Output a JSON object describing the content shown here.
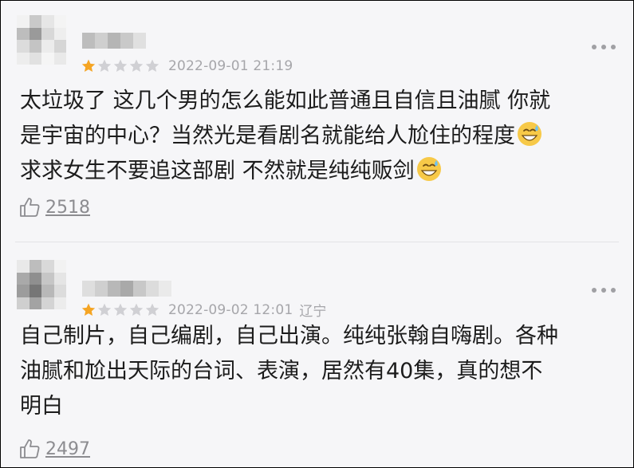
{
  "reviews": [
    {
      "rating": 1,
      "max_rating": 5,
      "date": "2022-09-01 21:19",
      "location": "",
      "content": "太垃圾了 这几个男的怎么能如此普通且自信且油腻 你就\n是宇宙的中心？当然光是看剧名就能给人尬住的程度",
      "content_line3": "求求女生不要追这部剧 不然就是纯纯贩剑",
      "likes": "2518"
    },
    {
      "rating": 1,
      "max_rating": 5,
      "date": "2022-09-02 12:01",
      "location": "辽宁",
      "content": "自己制片，自己编剧，自己出演。纯纯张翰自嗨剧。各种\n油腻和尬出天际的台词、表演，居然有40集，真的想不\n明白",
      "likes": "2497"
    }
  ],
  "icons": {
    "star_filled": "star-filled-icon",
    "star_empty": "star-empty-icon",
    "more": "more-dots-icon",
    "like": "thumbs-up-icon",
    "emoji": "sweat-smile-emoji"
  },
  "colors": {
    "star_filled": "#f5a524",
    "star_empty": "#d0d0d4",
    "meta_text": "#a6a6aa",
    "body_text": "#1c1c1c",
    "background": "#f6f6f8"
  }
}
